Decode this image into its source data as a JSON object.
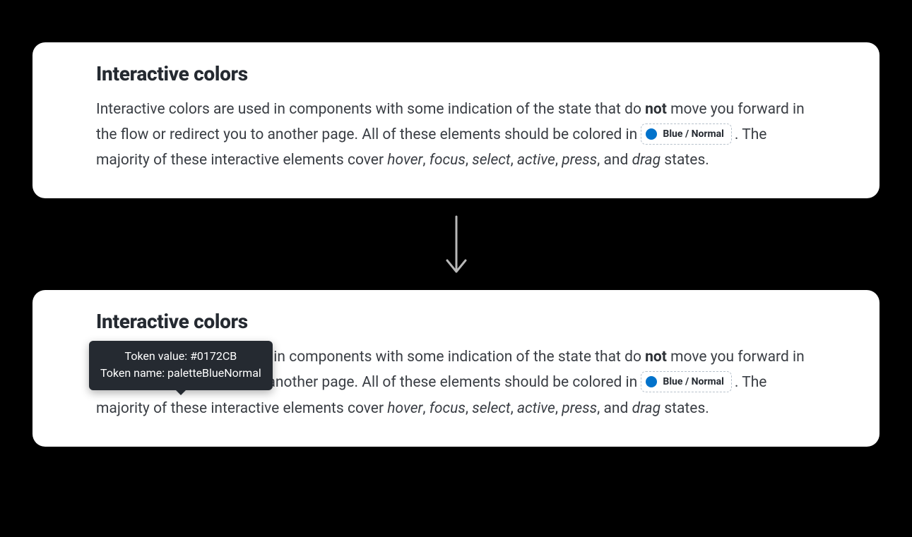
{
  "sections": {
    "top": {
      "title": "Interactive colors",
      "paragraph": {
        "part1": "Interactive colors are used in components with some indication of the state that do ",
        "bold": "not",
        "part2": " move you forward in the flow or redirect you to another page. All of these elements should be colored in ",
        "token": {
          "label": "Blue / Normal",
          "swatchColor": "#0172CB"
        },
        "part3": ". The majority of these interactive elements cover ",
        "states": {
          "s1": "hover",
          "c1": ", ",
          "s2": "focus",
          "c2": ", ",
          "s3": "select",
          "c3": ", ",
          "s4": "active",
          "c4": ", ",
          "s5": "press",
          "c5": ", and ",
          "s6": "drag"
        },
        "part4": " states."
      }
    },
    "bottom": {
      "title": "Interactive colors",
      "tooltip": {
        "line1": "Token value: #0172CB",
        "line2": "Token name: paletteBlueNormal"
      },
      "paragraph": {
        "part1": "Interactive colors are used in components with some indication of the state that do ",
        "bold": "not",
        "part2": " move you forward in the flow or redirect you to another page. All of these elements should be colored in ",
        "token": {
          "label": "Blue / Normal",
          "swatchColor": "#0172CB"
        },
        "part3": ". The majority of these interactive elements cover ",
        "states": {
          "s1": "hover",
          "c1": ", ",
          "s2": "focus",
          "c2": ", ",
          "s3": "select",
          "c3": ", ",
          "s4": "active",
          "c4": ", ",
          "s5": "press",
          "c5": ", and ",
          "s6": "drag"
        },
        "part4": " states."
      }
    }
  }
}
